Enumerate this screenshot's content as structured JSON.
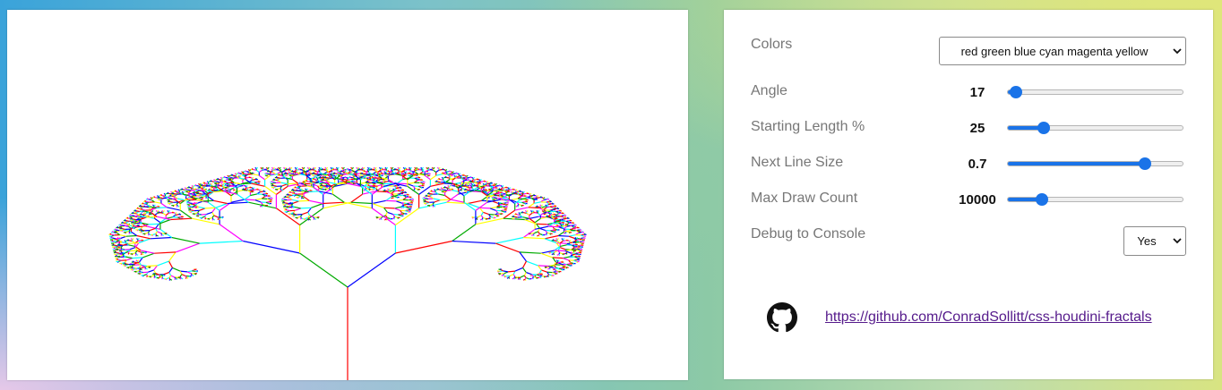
{
  "controls": {
    "colors": {
      "label": "Colors",
      "selected": "red green blue cyan magenta yellow"
    },
    "angle": {
      "label": "Angle",
      "value": "17",
      "fraction": 0.05
    },
    "starting_length": {
      "label": "Starting Length %",
      "value": "25",
      "fraction": 0.21
    },
    "next_line_size": {
      "label": "Next Line Size",
      "value": "0.7",
      "fraction": 0.78
    },
    "max_draw_count": {
      "label": "Max Draw Count",
      "value": "10000",
      "fraction": 0.2
    },
    "debug": {
      "label": "Debug to Console",
      "selected": "Yes"
    }
  },
  "footer": {
    "link_text": "https://github.com/ConradSollitt/css-houdini-fractals",
    "icon": "github-icon"
  },
  "fractal": {
    "palette": [
      "#ff0000",
      "#00aa00",
      "#0000ff",
      "#00ffff",
      "#ff00ff",
      "#ffff00"
    ],
    "angle_degrees": 17,
    "next_line_size": 0.7
  },
  "accent_color": "#1a73e8"
}
